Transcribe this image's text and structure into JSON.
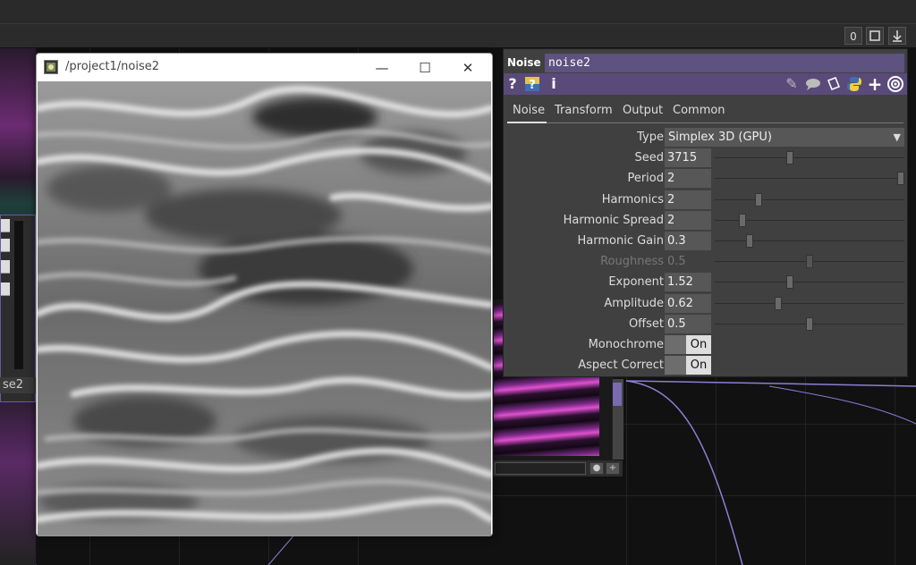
{
  "toolbar": {
    "counter": "0",
    "maximize_icon": "square-icon",
    "download_icon": "arrow-down-icon"
  },
  "left_node": {
    "label": "se2"
  },
  "viewer": {
    "title": "/project1/noise2",
    "minimize": "—",
    "maximize": "☐",
    "close": "✕"
  },
  "params": {
    "op_type": "Noise",
    "op_name": "noise2",
    "header_icons": {
      "help": "?",
      "python_help": "?",
      "info": "i",
      "edit": "✎",
      "comment": "💬",
      "clone": "⬚",
      "python": "🐍",
      "add": "+",
      "target": "◎"
    },
    "tabs": [
      "Noise",
      "Transform",
      "Output",
      "Common"
    ],
    "active_tab": "Noise",
    "rows": [
      {
        "label": "Type",
        "kind": "menu",
        "value": "Simplex 3D (GPU)"
      },
      {
        "label": "Seed",
        "kind": "slider",
        "value": "3715",
        "slider_pos": 0.39
      },
      {
        "label": "Period",
        "kind": "slider",
        "value": "2",
        "slider_pos": 1.0
      },
      {
        "label": "Harmonics",
        "kind": "slider",
        "value": "2",
        "slider_pos": 0.22
      },
      {
        "label": "Harmonic Spread",
        "kind": "slider",
        "value": "2",
        "slider_pos": 0.13
      },
      {
        "label": "Harmonic Gain",
        "kind": "slider",
        "value": "0.3",
        "slider_pos": 0.17
      },
      {
        "label": "Roughness",
        "kind": "slider",
        "value": "0.5",
        "slider_pos": 0.5,
        "disabled": true
      },
      {
        "label": "Exponent",
        "kind": "slider",
        "value": "1.52",
        "slider_pos": 0.39
      },
      {
        "label": "Amplitude",
        "kind": "slider",
        "value": "0.62",
        "slider_pos": 0.33
      },
      {
        "label": "Offset",
        "kind": "slider",
        "value": "0.5",
        "slider_pos": 0.5
      },
      {
        "label": "Monochrome",
        "kind": "toggle",
        "value": "On"
      },
      {
        "label": "Aspect Correct",
        "kind": "toggle",
        "value": "On"
      }
    ]
  },
  "colors": {
    "accent_purple": "#5e5280",
    "icon_row": "#5a4a7a",
    "node_border": "#6c59a8",
    "magenta": "#e050d0"
  }
}
